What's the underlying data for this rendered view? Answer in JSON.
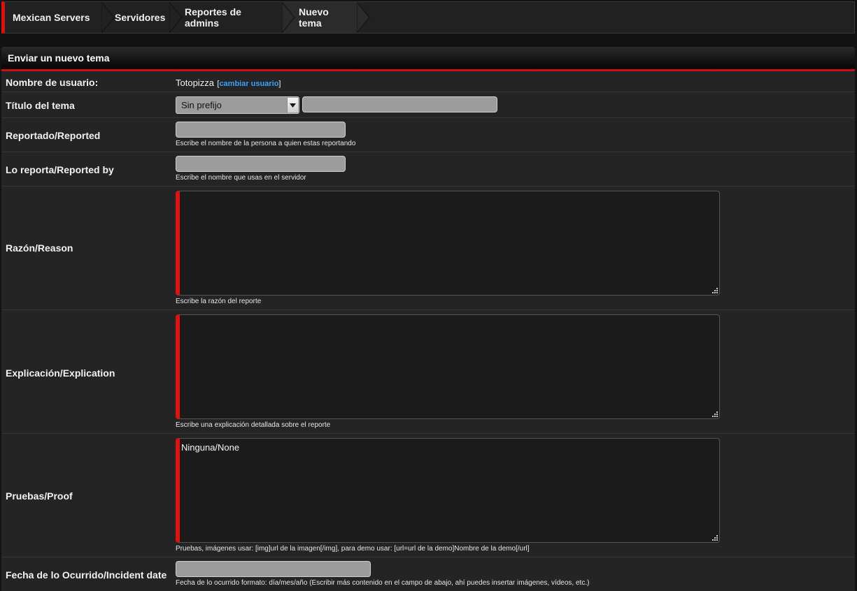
{
  "breadcrumb": {
    "items": [
      {
        "label": "Mexican Servers"
      },
      {
        "label": "Servidores"
      },
      {
        "label": "Reportes de admins"
      },
      {
        "label": "Nuevo tema"
      }
    ]
  },
  "panel": {
    "title": "Enviar un nuevo tema"
  },
  "form": {
    "username": {
      "label": "Nombre de usuario:",
      "value": "Totopizza",
      "bracket_open": "[",
      "change_link": "cambiar usuario",
      "bracket_close": "]"
    },
    "title": {
      "label": "Título del tema",
      "prefix_selected": "Sin prefijo",
      "value": ""
    },
    "reported": {
      "label": "Reportado/Reported",
      "value": "",
      "hint": "Escribe el nombre de la persona a quien estas reportando"
    },
    "reported_by": {
      "label": "Lo reporta/Reported by",
      "value": "",
      "hint": "Escribe el nombre que usas en el servidor"
    },
    "reason": {
      "label": "Razón/Reason",
      "value": "",
      "hint": "Escribe la razón del reporte"
    },
    "explanation": {
      "label": "Explicación/Explication",
      "value": "",
      "hint": "Escribe una explicación detallada sobre el reporte"
    },
    "proof": {
      "label": "Pruebas/Proof",
      "value": "Ninguna/None",
      "hint": "Pruebas, imágenes usar: [img]url de la imagen[/img], para demo usar: [url=url de la demo]Nombre de la demo[/url]"
    },
    "incident_date": {
      "label": "Fecha de lo Ocurrido/Incident date",
      "value": "",
      "hint": "Fecha de lo ocurrido formato: día/mes/año (Escribir más contenido en el campo de abajo, ahí puedes insertar imágenes, vídeos, etc.)"
    }
  },
  "colors": {
    "accent_red": "#d9120f",
    "link_blue": "#3aa0ff",
    "input_gray": "#9c9c9c"
  },
  "icons": {
    "select_arrow": "triangle-down-icon",
    "resize": "resize-grip-icon",
    "breadcrumb_separator": "chevron-right-icon"
  }
}
